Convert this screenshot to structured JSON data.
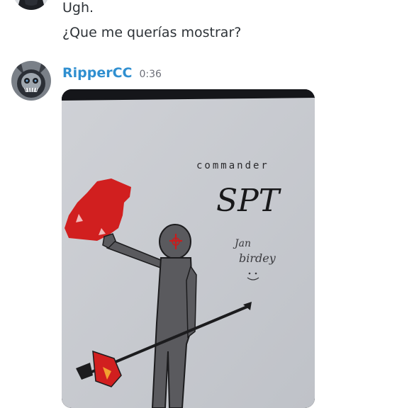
{
  "messages": {
    "previous": {
      "lines": [
        "Ugh.",
        "¿Que me querías mostrar?"
      ]
    },
    "current": {
      "username": "RipperCC",
      "timestamp": "0:36",
      "attachment": {
        "drawing_title": "commander",
        "drawing_name": "SPT",
        "drawing_note_1": "Jan",
        "drawing_note_2": "birdey"
      }
    }
  },
  "colors": {
    "username": "#2f8fd0",
    "message_text": "#2e3338",
    "timestamp": "#6d6f78"
  }
}
